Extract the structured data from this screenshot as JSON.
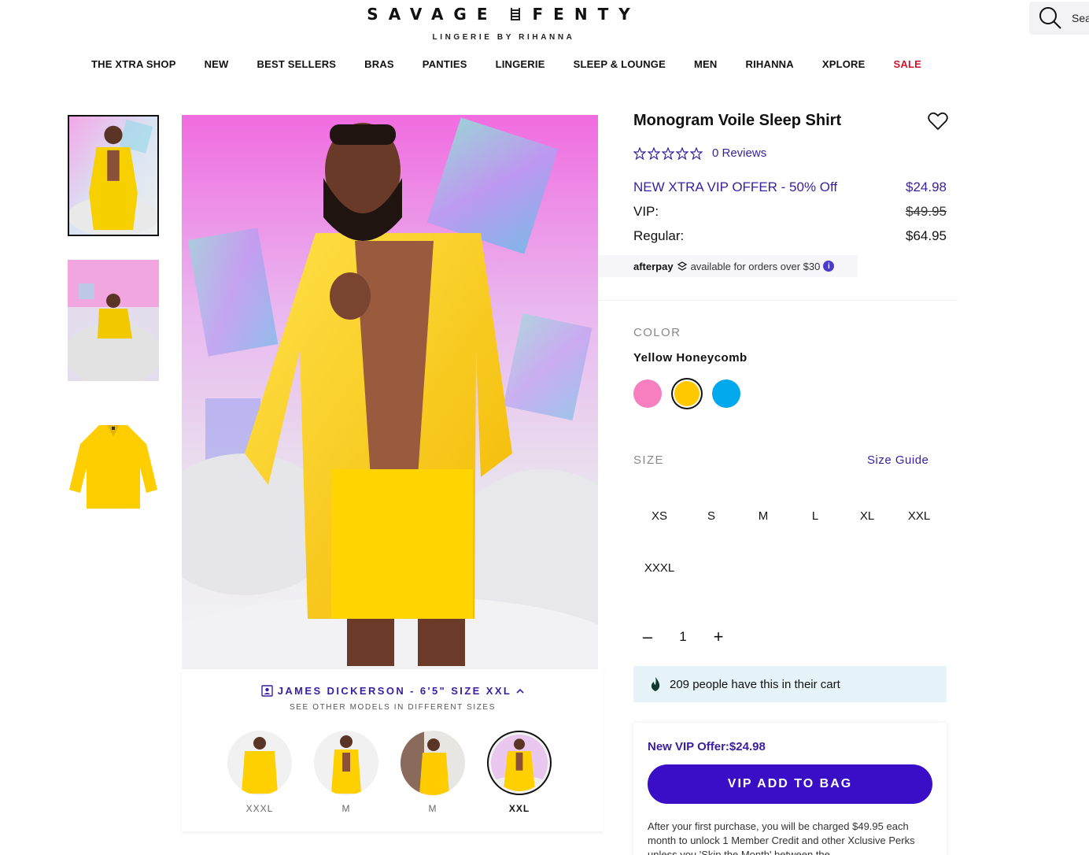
{
  "brand": {
    "name": "SAVAGE FENTY",
    "word1": "SAVAGE",
    "word2": "FENTY",
    "tagline": "LINGERIE BY RIHANNA"
  },
  "search": {
    "label": "Sea"
  },
  "nav": [
    {
      "label": "THE XTRA SHOP"
    },
    {
      "label": "NEW"
    },
    {
      "label": "BEST SELLERS"
    },
    {
      "label": "BRAS"
    },
    {
      "label": "PANTIES"
    },
    {
      "label": "LINGERIE"
    },
    {
      "label": "SLEEP & LOUNGE"
    },
    {
      "label": "MEN"
    },
    {
      "label": "RIHANNA"
    },
    {
      "label": "XPLORE"
    },
    {
      "label": "SALE"
    }
  ],
  "product": {
    "title": "Monogram Voile Sleep Shirt",
    "reviews": "0 Reviews",
    "rating": 0,
    "vip_offer_label": "NEW XTRA VIP OFFER - 50% Off",
    "vip_offer_price": "$24.98",
    "vip_label": "VIP:",
    "vip_price": "$49.95",
    "regular_label": "Regular:",
    "regular_price": "$64.95",
    "afterpay_brand": "afterpay",
    "afterpay_text": "available for orders over $30"
  },
  "color": {
    "label": "COLOR",
    "selected": "Yellow Honeycomb",
    "swatches": [
      "#f77fc0",
      "#ffc800",
      "#00a8ec"
    ]
  },
  "size": {
    "label": "SIZE",
    "guide": "Size Guide",
    "options": [
      "XS",
      "S",
      "M",
      "L",
      "XL",
      "XXL",
      "XXXL"
    ]
  },
  "quantity": {
    "minus": "–",
    "value": "1",
    "plus": "+"
  },
  "cart_notice": "209 people have this in their cart",
  "vip_box": {
    "offer_label": "New VIP Offer:",
    "offer_price": "$24.98",
    "button": "VIP ADD TO BAG",
    "terms": "After your first purchase, you will be charged $49.95 each month to unlock 1 Member Credit and other Xclusive Perks unless you 'Skip the Month' between the"
  },
  "model_info": {
    "name": "JAMES DICKERSON - 6'5\" SIZE XXL",
    "sub": "SEE OTHER MODELS IN DIFFERENT SIZES",
    "models": [
      {
        "size": "XXXL"
      },
      {
        "size": "M"
      },
      {
        "size": "M"
      },
      {
        "size": "XXL"
      }
    ]
  },
  "colors": {
    "accent": "#3a1ea0",
    "button": "#3a0ec6",
    "sale": "#d0132d",
    "notice_bg": "#e6f3f8"
  }
}
